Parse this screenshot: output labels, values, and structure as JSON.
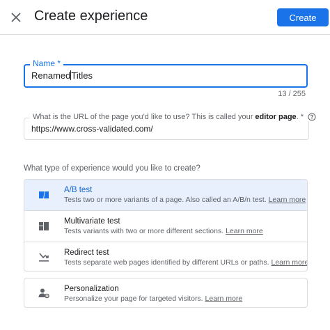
{
  "header": {
    "title": "Create experience",
    "create_label": "Create"
  },
  "form": {
    "name": {
      "label": "Name",
      "required_mark": "*",
      "value_before_cursor": "Renamed",
      "value_after_cursor": "Titles",
      "char_count": "13 / 255"
    },
    "url": {
      "label_prefix": "What is the URL of the page you'd like to use? This is called your",
      "label_bold": "editor page",
      "label_suffix": ". *",
      "value": "https://www.cross-validated.com/"
    },
    "question": "What type of experience would you like to create?",
    "learn_more": "Learn more",
    "options": [
      {
        "title": "A/B test",
        "description": "Tests two or more variants of a page. Also called an A/B/n test.",
        "icon": "ab-test-icon",
        "selected": true
      },
      {
        "title": "Multivariate test",
        "description": "Tests variants with two or more different sections.",
        "icon": "multivariate-icon",
        "selected": false
      },
      {
        "title": "Redirect test",
        "description": "Tests separate web pages identified by different URLs or paths.",
        "icon": "redirect-icon",
        "selected": false
      },
      {
        "title": "Personalization",
        "description": "Personalize your page for targeted visitors.",
        "icon": "personalization-icon",
        "selected": false
      }
    ]
  },
  "colors": {
    "accent": "#1a73e8",
    "selected_bg": "#e8f0fe",
    "border": "#dadce0",
    "muted_text": "#5f6368"
  }
}
